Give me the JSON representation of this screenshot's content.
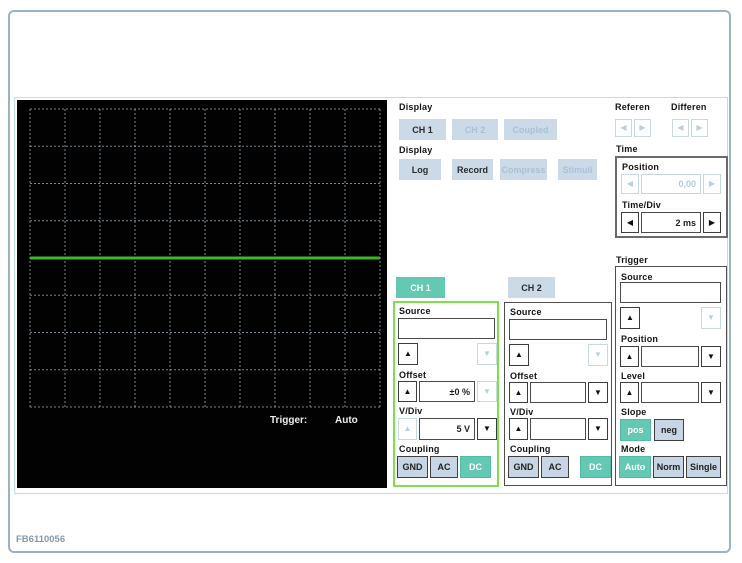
{
  "footer_id": "FB6110056",
  "icons": {
    "up": "▲",
    "down": "▼",
    "left": "◀",
    "right": "▶"
  },
  "colors": {
    "accent_teal": "#63c9b2",
    "panel_green": "#7fdf50",
    "button_bg": "#ccd9e7",
    "trace_green": "#3db629",
    "grid_line": "#9aa6b4"
  },
  "scope": {
    "trigger_label": "Trigger:",
    "trigger_mode": "Auto",
    "grid": {
      "cols": 10,
      "rows": 8
    },
    "trace_row": 4,
    "trace_color": "#3db629"
  },
  "display_channels": {
    "label": "Display",
    "ch1": "CH 1",
    "ch2": "CH 2",
    "coupled": "Coupled"
  },
  "display_modes": {
    "label": "Display",
    "log": "Log",
    "record": "Record",
    "compress": "Compress",
    "stimuli": "Stimuli"
  },
  "reference": {
    "label": "Referen"
  },
  "difference": {
    "label": "Differen"
  },
  "time": {
    "label": "Time",
    "position": {
      "label": "Position",
      "value": "0,00"
    },
    "timediv": {
      "label": "Time/Div",
      "value": "2 ms"
    }
  },
  "trigger": {
    "label": "Trigger",
    "source_label": "Source",
    "source_value": "",
    "position": {
      "label": "Position",
      "value": ""
    },
    "level": {
      "label": "Level",
      "value": ""
    },
    "slope": {
      "label": "Slope",
      "pos": "pos",
      "neg": "neg",
      "selected": "pos"
    },
    "mode": {
      "label": "Mode",
      "auto": "Auto",
      "norm": "Norm",
      "single": "Single",
      "selected": "Auto"
    }
  },
  "ch1": {
    "button": "CH 1",
    "source_label": "Source",
    "source_value": "",
    "offset": {
      "label": "Offset",
      "value": "±0 %"
    },
    "vdiv": {
      "label": "V/Div",
      "value": "5 V"
    },
    "coupling": {
      "label": "Coupling",
      "gnd": "GND",
      "ac": "AC",
      "dc": "DC",
      "selected": "DC"
    }
  },
  "ch2": {
    "button": "CH 2",
    "source_label": "Source",
    "source_value": "",
    "offset": {
      "label": "Offset",
      "value": ""
    },
    "vdiv": {
      "label": "V/Div",
      "value": ""
    },
    "coupling": {
      "label": "Coupling",
      "gnd": "GND",
      "ac": "AC",
      "dc": "DC",
      "selected": "DC"
    }
  }
}
